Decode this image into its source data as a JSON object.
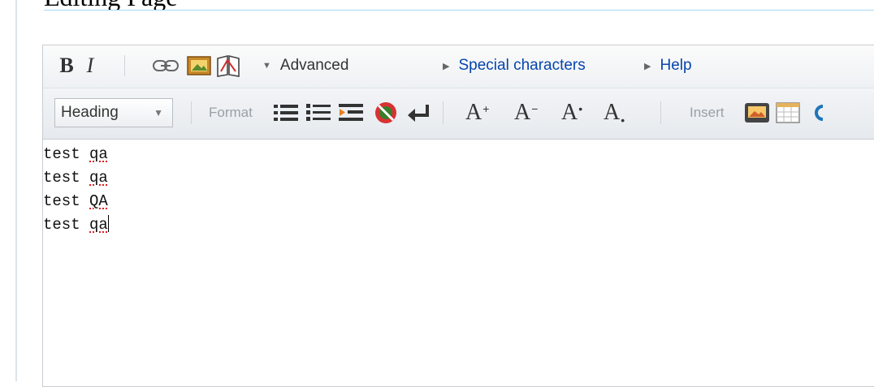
{
  "editor": {
    "toolbar": {
      "bold_label": "B",
      "italic_label": "I",
      "link_icon": "link-icon",
      "image_icon": "embedded-file-icon",
      "reference_icon": "reference-icon",
      "advanced_label": "Advanced",
      "special_characters_label": "Special characters",
      "help_label": "Help"
    },
    "advanced_toolbar": {
      "heading_select": "Heading",
      "format_label": "Format",
      "insert_label": "Insert",
      "big_label": "A",
      "big_mark": "+",
      "small_label": "A",
      "small_mark": "−",
      "superscript_label": "A",
      "superscript_mark": "•",
      "subscript_label": "A",
      "subscript_mark": "•",
      "icons": [
        "bulleted-list-icon",
        "numbered-list-icon",
        "indent-icon",
        "nowiki-icon",
        "newline-icon",
        "picture-gallery-icon",
        "table-icon"
      ]
    },
    "content": {
      "lines": [
        {
          "word": "test",
          "misspelled": "qa"
        },
        {
          "word": "test",
          "misspelled": "qa"
        },
        {
          "word": "test",
          "misspelled": "QA"
        },
        {
          "word": "test",
          "misspelled": "qa"
        }
      ]
    }
  },
  "colors": {
    "link": "#0645ad",
    "spellcheck_underline": "#dd1111"
  }
}
